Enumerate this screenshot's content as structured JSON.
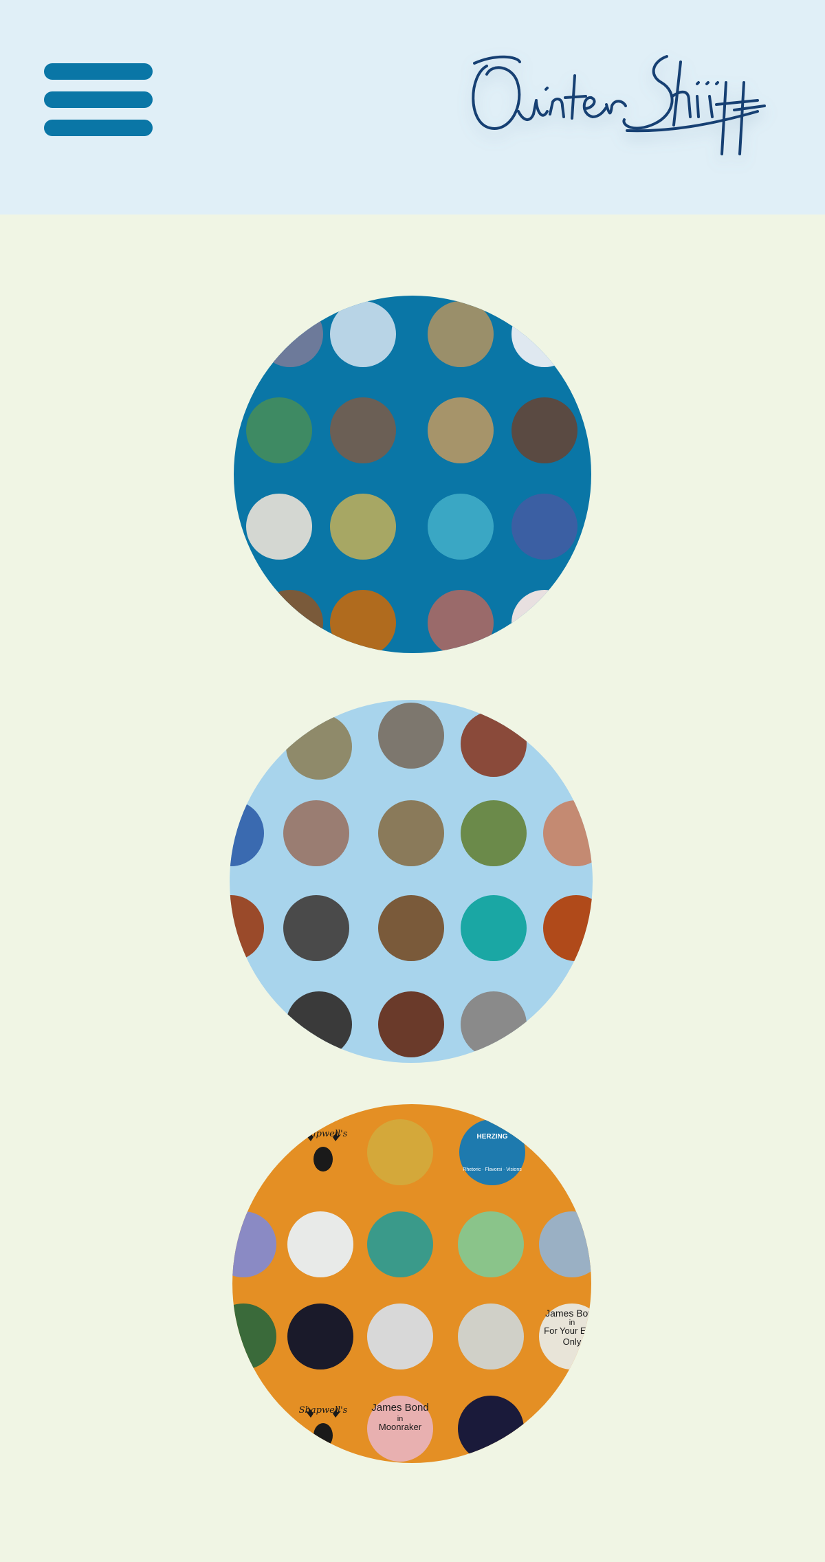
{
  "header": {
    "menu_icon": "hamburger-menu-icon",
    "logo": {
      "text": "Quinter Shiff",
      "kind": "handwritten-signature"
    }
  },
  "galleries": [
    {
      "id": "art",
      "background": "#0a76a6",
      "dots": [
        "#6d7a9a",
        "#b8d4e6",
        "#9a8f6a",
        "#dfe8f0",
        "#3e8a63",
        "#6b5f55",
        "#a6946a",
        "#5a4a42",
        "#d4d7d2",
        "#a7a764",
        "#3aa7c4",
        "#3b5fa3",
        "#7a5a3a",
        "#b06b1e",
        "#9a6a6a",
        "#e8e0e0"
      ]
    },
    {
      "id": "photos",
      "background": "#a8d4ec",
      "dots": [
        "#8f8a6a",
        "#7d776e",
        "#8a4a3a",
        "#3a6ab0",
        "#9a7d72",
        "#8a7a5a",
        "#6b8a4a",
        "#c48a72",
        "#9a4a2a",
        "#4a4a4a",
        "#7a5a3a",
        "#1aa7a4",
        "#b04a1a",
        "#3a3a3a",
        "#6a3a2a",
        "#8a8a8a"
      ]
    },
    {
      "id": "design",
      "background": "#e48f24",
      "dots": [
        "#2a1a0a",
        "#d4a83a",
        "#1e7aae",
        "#2a2a2a",
        "#8a8ac4",
        "#e8eae8",
        "#3a9a8a",
        "#8ac48a",
        "#9ab0c4",
        "#3a6a3a",
        "#1a1a2a",
        "#d8d8d8",
        "#d0d0c8",
        "#e8e4d8",
        "#3a2a1a",
        "#e8b0b0",
        "#1a1a3a"
      ],
      "labels": [
        {
          "title": "James Bond",
          "line2": "in",
          "line3": "For Your Eyes Only"
        },
        {
          "title": "James Bond",
          "line2": "in",
          "line3": "Moonraker"
        }
      ],
      "logos": [
        {
          "brand": "Shapwell's"
        },
        {
          "brand": "HERZING",
          "tagline": "Rhetoric · Flavorsi · Visions"
        },
        {
          "brand": "Shapwell's"
        }
      ]
    }
  ]
}
